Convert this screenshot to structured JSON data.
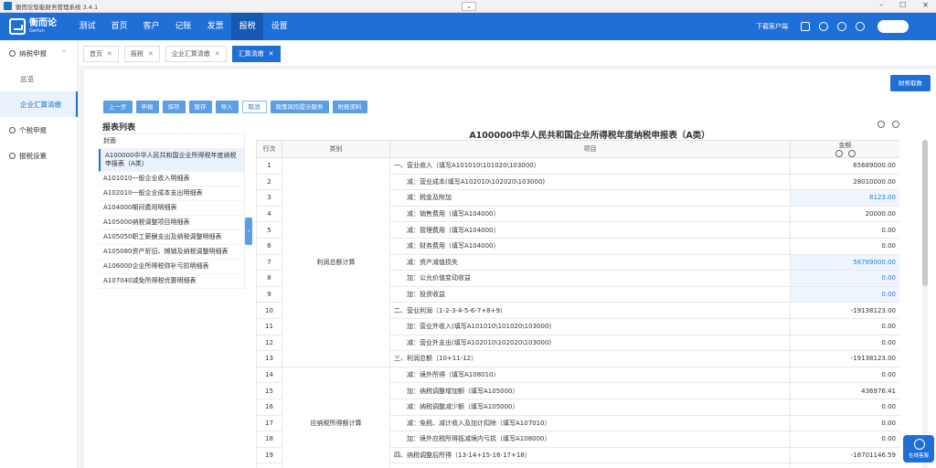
{
  "window": {
    "title": "衡而论智能财务管理系统 3.4.1",
    "collapse": "⌄",
    "min": "–",
    "max": "☐",
    "close": "✕"
  },
  "brand": {
    "cn": "衡而论",
    "en": "Gerlun"
  },
  "nav": {
    "items": [
      "测试",
      "首页",
      "客户",
      "记账",
      "发票",
      "报税",
      "设置"
    ],
    "active_index": 5
  },
  "topright": {
    "download": "下载客户端"
  },
  "sidebar": {
    "group1": "纳税申报",
    "sub1": "总览",
    "sub2": "企业汇算清缴",
    "group2": "个税申报",
    "group3": "报税设置"
  },
  "tabs": [
    {
      "label": "首页",
      "close": "✕"
    },
    {
      "label": "报税",
      "close": "✕"
    },
    {
      "label": "企业汇算清缴",
      "close": "✕"
    },
    {
      "label": "汇算清缴",
      "close": "✕"
    }
  ],
  "finance_button": "财务取数",
  "actions": [
    "上一步",
    "申报",
    "保存",
    "暂存",
    "导入",
    "取消",
    "政策风险提示服务",
    "附报资料"
  ],
  "report_list": {
    "title": "报表列表",
    "items": [
      "封面",
      "A100000中华人民共和国企业所得税年度纳税申报表（A类）",
      "A101010一般企业收入明细表",
      "A102010一般企业成本支出明细表",
      "A104000期间费用明细表",
      "A105000纳税调整项目明细表",
      "A105050职工薪酬支出及纳税调整明细表",
      "A105080资产折旧、摊销及纳税调整明细表",
      "A106000企业所得税弥补亏损明细表",
      "A107040减免所得税优惠明细表"
    ],
    "selected_index": 1,
    "handle": "‹"
  },
  "form": {
    "title": "A100000中华人民共和国企业所得税年度纳税申报表（A类）",
    "headers": {
      "no": "行次",
      "category": "类别",
      "item": "项目",
      "amount": "金额"
    },
    "cat1": "利润总额计算",
    "cat2": "应纳税所得额计算",
    "rows": [
      {
        "no": "1",
        "item": "一、营业收入（填写A101010\\101020\\103000）",
        "amount": "65689000.00"
      },
      {
        "no": "2",
        "item": "　　减：营业成本(填写A102010\\102020\\103000)",
        "amount": "28010000.00"
      },
      {
        "no": "3",
        "item": "　　减：税金及附加",
        "amount": "8123.00"
      },
      {
        "no": "4",
        "item": "　　减：销售费用（填写A104000）",
        "amount": "20000.00"
      },
      {
        "no": "5",
        "item": "　　减：管理费用（填写A104000）",
        "amount": "0.00"
      },
      {
        "no": "6",
        "item": "　　减：财务费用（填写A104000）",
        "amount": "0.00"
      },
      {
        "no": "7",
        "item": "　　减：资产减值损失",
        "amount": "56789000.00"
      },
      {
        "no": "8",
        "item": "　　加：公允价值变动收益",
        "amount": "0.00"
      },
      {
        "no": "9",
        "item": "　　加：投资收益",
        "amount": "0.00"
      },
      {
        "no": "10",
        "item": "二、营业利润（1-2-3-4-5-6-7+8+9）",
        "amount": "-19138123.00"
      },
      {
        "no": "11",
        "item": "　　加：营业外收入(填写A101010\\101020\\103000)",
        "amount": "0.00"
      },
      {
        "no": "12",
        "item": "　　减：营业外支出(填写A102010\\102020\\103000)",
        "amount": "0.00"
      },
      {
        "no": "13",
        "item": "三、利润总额（10+11-12）",
        "amount": "-19138123.00"
      },
      {
        "no": "14",
        "item": "　　减：境外所得（填写A108010）",
        "amount": "0.00"
      },
      {
        "no": "15",
        "item": "　　加：纳税调整增加额（填写A105000）",
        "amount": "436976.41"
      },
      {
        "no": "16",
        "item": "　　减：纳税调整减少额（填写A105000）",
        "amount": "0.00"
      },
      {
        "no": "17",
        "item": "　　减：免税、减计收入及加计扣除（填写A107010）",
        "amount": "0.00"
      },
      {
        "no": "18",
        "item": "　　加：境外应税所得抵减境内亏损（填写A108000）",
        "amount": "0.00"
      },
      {
        "no": "19",
        "item": "四、纳税调整后所得（13-14+15-16-17+18）",
        "amount": "-18701146.59"
      },
      {
        "no": "20",
        "item": "",
        "amount": ""
      }
    ]
  },
  "support": "在线客服"
}
